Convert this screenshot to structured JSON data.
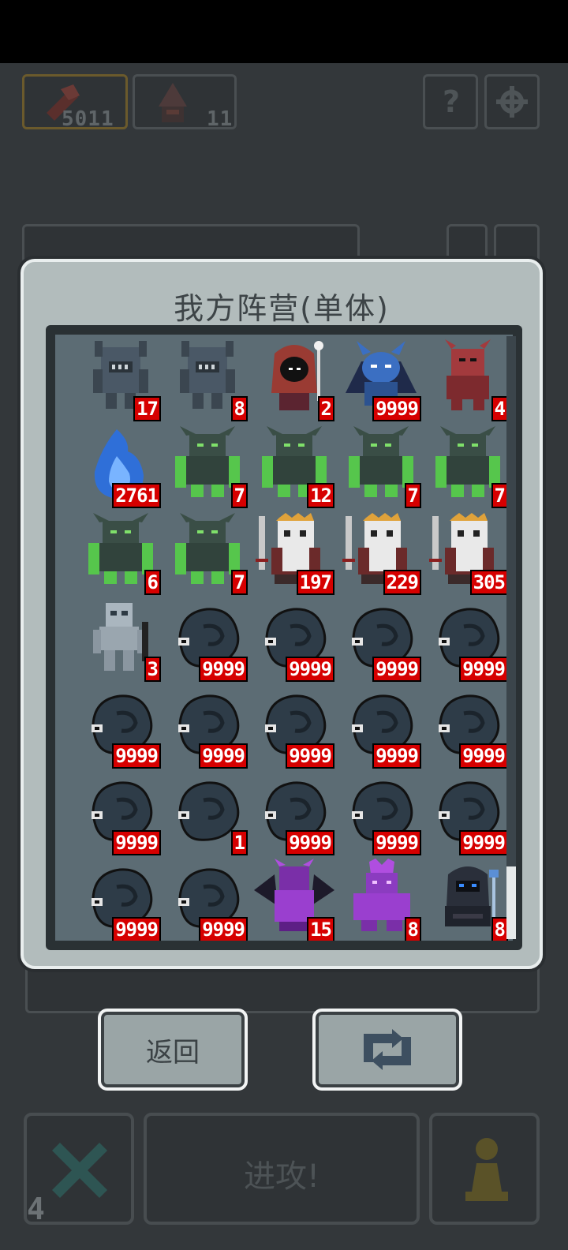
{
  "hud": {
    "resource_count": "5011",
    "unit_count": "11",
    "help_icon": "question-mark-icon",
    "settings_icon": "gear-icon",
    "level": "4"
  },
  "modal": {
    "title": "我方阵营(单体)",
    "units": [
      {
        "type": "stone-golem",
        "count": "17"
      },
      {
        "type": "stone-golem",
        "count": "8"
      },
      {
        "type": "red-hooded-mage",
        "count": "2"
      },
      {
        "type": "blue-demon",
        "count": "9999"
      },
      {
        "type": "red-imp",
        "count": "4"
      },
      {
        "type": "blue-flame-spirit",
        "count": "2761"
      },
      {
        "type": "green-gargoyle",
        "count": "7"
      },
      {
        "type": "green-gargoyle",
        "count": "12"
      },
      {
        "type": "green-gargoyle",
        "count": "7"
      },
      {
        "type": "green-gargoyle",
        "count": "7"
      },
      {
        "type": "green-gargoyle",
        "count": "6"
      },
      {
        "type": "green-gargoyle",
        "count": "7"
      },
      {
        "type": "skeleton-king",
        "count": "197"
      },
      {
        "type": "skeleton-king",
        "count": "229"
      },
      {
        "type": "skeleton-king",
        "count": "305"
      },
      {
        "type": "skeleton-warrior",
        "count": "3"
      },
      {
        "type": "shadow-ghost",
        "count": "9999"
      },
      {
        "type": "shadow-ghost",
        "count": "9999"
      },
      {
        "type": "shadow-ghost",
        "count": "9999"
      },
      {
        "type": "shadow-ghost",
        "count": "9999"
      },
      {
        "type": "shadow-ghost",
        "count": "9999"
      },
      {
        "type": "shadow-ghost",
        "count": "9999"
      },
      {
        "type": "shadow-ghost",
        "count": "9999"
      },
      {
        "type": "shadow-ghost",
        "count": "9999"
      },
      {
        "type": "shadow-ghost",
        "count": "9999"
      },
      {
        "type": "shadow-ghost",
        "count": "9999"
      },
      {
        "type": "shadow-ghost",
        "count": "1"
      },
      {
        "type": "shadow-ghost",
        "count": "9999"
      },
      {
        "type": "shadow-ghost",
        "count": "9999"
      },
      {
        "type": "shadow-ghost",
        "count": "9999"
      },
      {
        "type": "shadow-ghost",
        "count": "9999"
      },
      {
        "type": "shadow-ghost",
        "count": "9999"
      },
      {
        "type": "purple-dragon",
        "count": "15"
      },
      {
        "type": "purple-golem",
        "count": "8"
      },
      {
        "type": "dark-knight",
        "count": "8"
      }
    ]
  },
  "buttons": {
    "back_label": "返回",
    "swap_icon": "swap-icon",
    "attack_label": "进攻!",
    "cancel_icon": "x-icon",
    "pawn_icon": "pawn-icon"
  },
  "colors": {
    "badge_red": "#d60000",
    "modal_bg": "#b2bcbc",
    "grid_bg": "#5c6c74"
  }
}
